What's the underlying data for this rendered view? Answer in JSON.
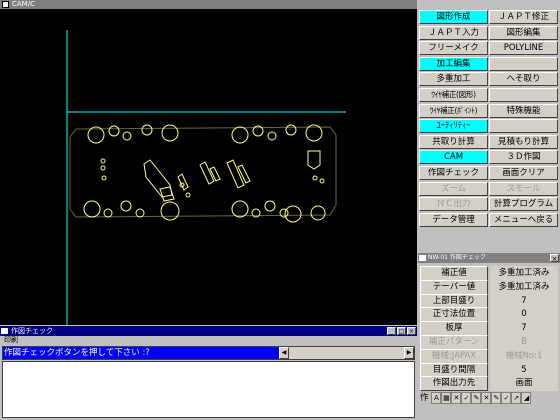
{
  "app": {
    "title": "CAM/C"
  },
  "canvas": {
    "background": "#000000",
    "line_color": "#ffff80",
    "axis_color": "#00ffff"
  },
  "menu_buttons": [
    {
      "label": "図形作成",
      "highlighted": true
    },
    {
      "label": "ＪＡＰＴ修正",
      "highlighted": false
    },
    {
      "label": "ＪＡＰＴ入力",
      "highlighted": false
    },
    {
      "label": "図形編集",
      "highlighted": false
    },
    {
      "label": "フリーメイク",
      "highlighted": false
    },
    {
      "label": "POLYLINE",
      "highlighted": false
    },
    {
      "label": "加工編集",
      "highlighted": true
    },
    {
      "label": "",
      "highlighted": false
    },
    {
      "label": "多重加工",
      "highlighted": false
    },
    {
      "label": "ヘそ取り",
      "highlighted": false
    },
    {
      "label": "ﾜｲﾔ補正(図形)",
      "highlighted": false
    },
    {
      "label": "",
      "highlighted": false
    },
    {
      "label": "ﾜｲﾔ補正(ﾎﾟｲﾝﾄ)",
      "highlighted": false
    },
    {
      "label": "特殊機能",
      "highlighted": false
    },
    {
      "label": "ﾕｰﾃｨﾘﾃｨｰ",
      "highlighted": true
    },
    {
      "label": "",
      "highlighted": false
    },
    {
      "label": "共取り計算",
      "highlighted": false
    },
    {
      "label": "見積もり計算",
      "highlighted": false
    },
    {
      "label": "CAM",
      "highlighted": true
    },
    {
      "label": "３Ｄ作図",
      "highlighted": false
    },
    {
      "label": "作図チェック",
      "highlighted": false
    },
    {
      "label": "画面クリア",
      "highlighted": false
    },
    {
      "label": "ズーム",
      "highlighted": false,
      "disabled": true
    },
    {
      "label": "スモール",
      "highlighted": false,
      "disabled": true
    },
    {
      "label": "ＮＣ出力",
      "highlighted": false,
      "disabled": true
    },
    {
      "label": "計算プログラム",
      "highlighted": false
    },
    {
      "label": "データ管理",
      "highlighted": false
    },
    {
      "label": "メニューへ戻る",
      "highlighted": false
    }
  ],
  "check_panel": {
    "title": "NW-01 作図チェック",
    "rows": [
      {
        "label": "補正値",
        "value": "多重加工済み",
        "disabled": false
      },
      {
        "label": "テーパー値",
        "value": "多重加工済み",
        "disabled": false
      },
      {
        "label": "上部目盛り",
        "value": "7",
        "disabled": false
      },
      {
        "label": "正寸法位置",
        "value": "0",
        "disabled": false
      },
      {
        "label": "板厚",
        "value": "7",
        "disabled": false
      },
      {
        "label": "補正パターン",
        "value": "B",
        "disabled": true
      },
      {
        "label": "機械:JAPAX",
        "value": "機械No:1",
        "disabled": true
      },
      {
        "label": "目盛り間隔",
        "value": "5",
        "disabled": false
      },
      {
        "label": "作図出力先",
        "value": "画面",
        "disabled": false
      }
    ],
    "icon_row_label": "作"
  },
  "check_window": {
    "title": "作図チェック",
    "menu": "印刷",
    "message": "作図チェックボタンを押して下さい :?",
    "scroll_left": "◀",
    "scroll_right": "▶"
  }
}
